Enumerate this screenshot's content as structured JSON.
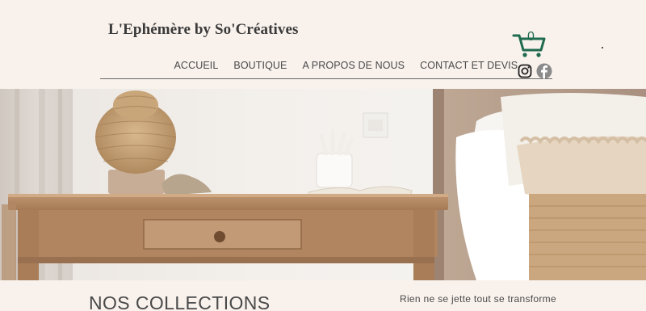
{
  "site": {
    "title": "L'Ephémère by So'Créatives"
  },
  "nav": {
    "items": [
      {
        "label": "ACCUEIL"
      },
      {
        "label": "BOUTIQUE"
      },
      {
        "label": "A PROPOS DE NOUS"
      },
      {
        "label": "CONTACT ET DEVIS"
      }
    ]
  },
  "cart": {
    "count": "0",
    "icon": "shopping-cart-icon",
    "color": "#1f6b4f"
  },
  "social": {
    "items": [
      {
        "icon": "instagram-icon"
      },
      {
        "icon": "facebook-icon"
      }
    ]
  },
  "hero": {
    "image": "bedside-table-with-lamp-photo"
  },
  "section": {
    "title": "NOS COLLECTIONS",
    "tagline": "Rien ne se jette tout se transforme"
  },
  "colors": {
    "background": "#f8f1ec",
    "accent": "#1f6b4f"
  }
}
